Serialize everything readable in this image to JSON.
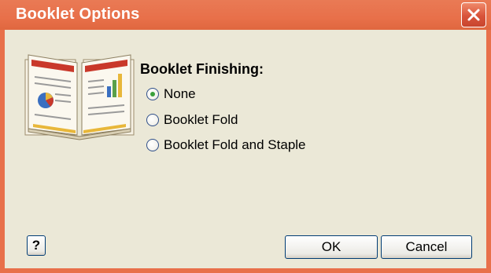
{
  "window": {
    "title": "Booklet Options",
    "close_icon": "close-x-icon",
    "colors": {
      "titlebar": "#e8704a",
      "client": "#ebe8d7",
      "close": "#d8533a"
    }
  },
  "finishing": {
    "label": "Booklet Finishing:",
    "icon": "booklet-icon",
    "options": [
      {
        "label": "None",
        "selected": true
      },
      {
        "label": "Booklet Fold",
        "selected": false
      },
      {
        "label": "Booklet Fold and Staple",
        "selected": false
      }
    ]
  },
  "buttons": {
    "help_label": "?",
    "ok_label": "OK",
    "cancel_label": "Cancel"
  }
}
